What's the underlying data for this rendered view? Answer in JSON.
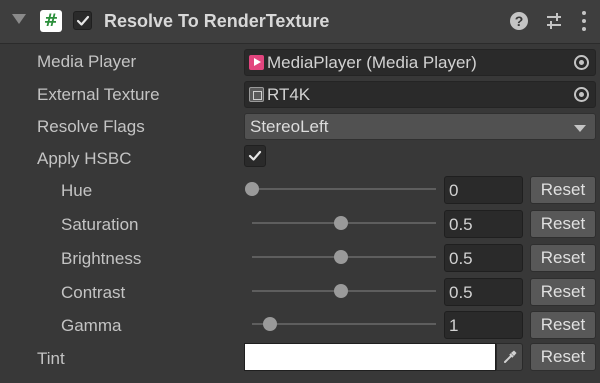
{
  "header": {
    "title": "Resolve To RenderTexture",
    "script_icon": "#",
    "enabled": true,
    "help_icon": "?"
  },
  "fields": {
    "media_player": {
      "label": "Media Player",
      "value": "MediaPlayer (Media Player)",
      "icon": "media-player-icon"
    },
    "external_texture": {
      "label": "External Texture",
      "value": "RT4K",
      "icon": "render-texture-icon"
    },
    "resolve_flags": {
      "label": "Resolve Flags",
      "value": "StereoLeft"
    },
    "apply_hsbc": {
      "label": "Apply HSBC",
      "checked": true
    }
  },
  "sliders": [
    {
      "label": "Hue",
      "value": "0",
      "level": 0.0
    },
    {
      "label": "Saturation",
      "value": "0.5",
      "level": 0.5
    },
    {
      "label": "Brightness",
      "value": "0.5",
      "level": 0.5
    },
    {
      "label": "Contrast",
      "value": "0.5",
      "level": 0.5
    },
    {
      "label": "Gamma",
      "value": "1",
      "level": 0.1
    }
  ],
  "tint": {
    "label": "Tint",
    "color": "#ffffff"
  },
  "reset_label": "Reset",
  "colors": {
    "accent_media_player": "#e2457e",
    "script_icon_green": "#2c8f3c"
  }
}
